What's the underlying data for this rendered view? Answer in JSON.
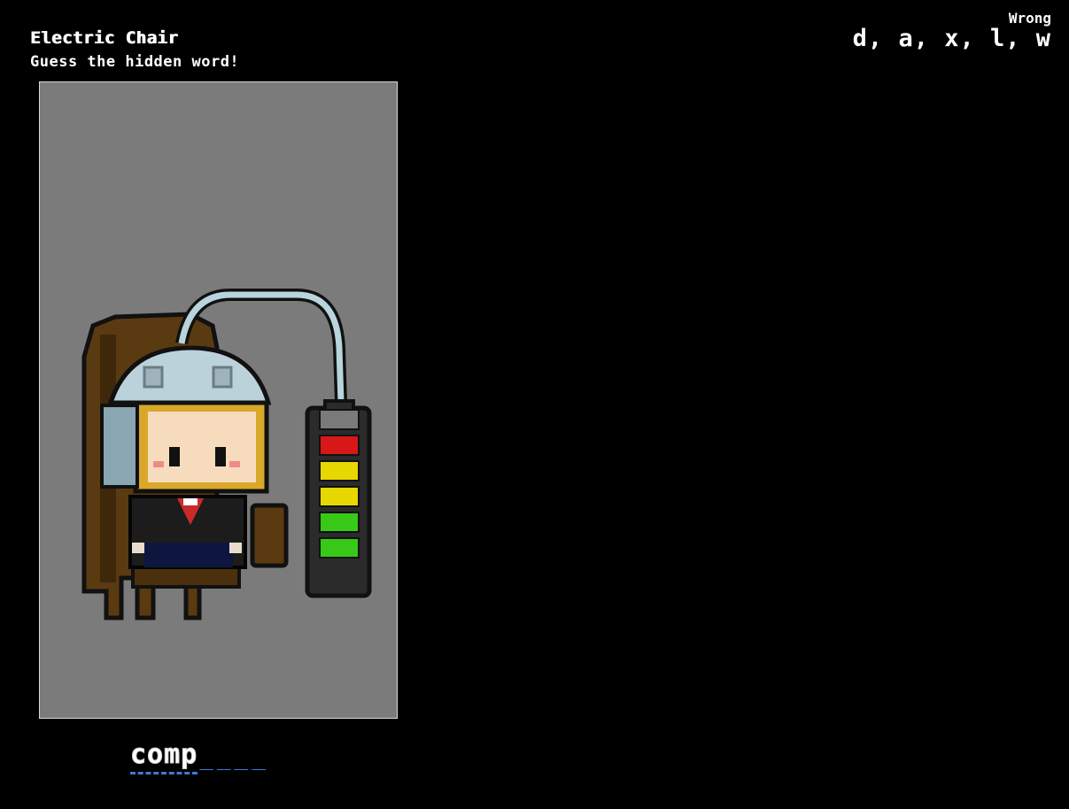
{
  "game": {
    "title": "Electric Chair",
    "subtitle": "Guess the hidden word!"
  },
  "wrong": {
    "label": "Wrong",
    "letters": "d, a, x, l, w"
  },
  "word": {
    "revealed": "comp",
    "blanks": "____"
  },
  "meter": {
    "segments_total": 6,
    "colors": [
      "#7a7a7a",
      "#d81818",
      "#e6d800",
      "#e6d800",
      "#38c818",
      "#38c818"
    ]
  },
  "colors": {
    "background": "#000000",
    "panel": "#7b7b7b",
    "underline": "#3a7ad6"
  },
  "icons": [
    "electric-chair-icon",
    "helmet-icon",
    "battery-meter-icon"
  ]
}
